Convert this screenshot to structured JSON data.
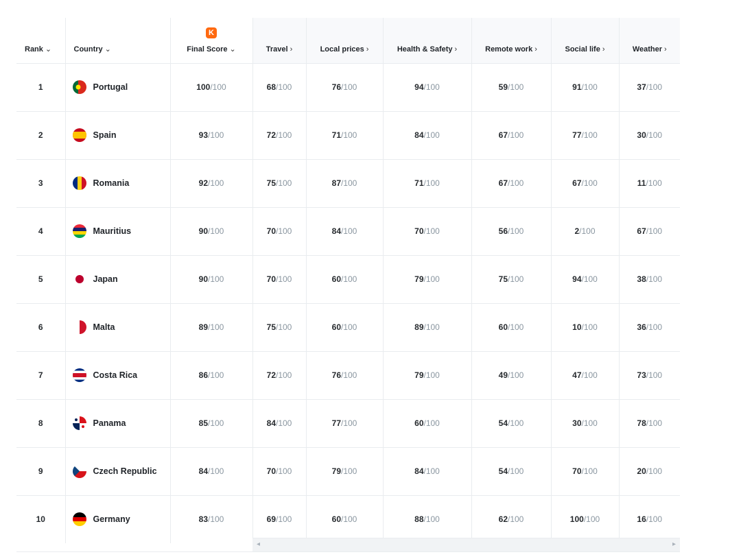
{
  "headers": {
    "rank": "Rank",
    "country": "Country",
    "final_score": "Final Score",
    "travel": "Travel",
    "local_prices": "Local prices",
    "health_safety": "Health & Safety",
    "remote_work": "Remote work",
    "social_life": "Social life",
    "weather": "Weather",
    "sort_caret": "⌄",
    "more_caret": "›",
    "logo_letter": "K"
  },
  "denominator": "/100",
  "scrollbar": {
    "left_arrow": "◂",
    "right_arrow": "▸"
  },
  "rows": [
    {
      "rank": "1",
      "country": "Portugal",
      "flag": "portugal-flag-icon",
      "scores": [
        "100",
        "68",
        "76",
        "94",
        "59",
        "91",
        "37"
      ]
    },
    {
      "rank": "2",
      "country": "Spain",
      "flag": "spain-flag-icon",
      "scores": [
        "93",
        "72",
        "71",
        "84",
        "67",
        "77",
        "30"
      ]
    },
    {
      "rank": "3",
      "country": "Romania",
      "flag": "romania-flag-icon",
      "scores": [
        "92",
        "75",
        "87",
        "71",
        "67",
        "67",
        "11"
      ]
    },
    {
      "rank": "4",
      "country": "Mauritius",
      "flag": "mauritius-flag-icon",
      "scores": [
        "90",
        "70",
        "84",
        "70",
        "56",
        "2",
        "67"
      ]
    },
    {
      "rank": "5",
      "country": "Japan",
      "flag": "japan-flag-icon",
      "scores": [
        "90",
        "70",
        "60",
        "79",
        "75",
        "94",
        "38"
      ]
    },
    {
      "rank": "6",
      "country": "Malta",
      "flag": "malta-flag-icon",
      "scores": [
        "89",
        "75",
        "60",
        "89",
        "60",
        "10",
        "36"
      ]
    },
    {
      "rank": "7",
      "country": "Costa Rica",
      "flag": "costa-rica-flag-icon",
      "scores": [
        "86",
        "72",
        "76",
        "79",
        "49",
        "47",
        "73"
      ]
    },
    {
      "rank": "8",
      "country": "Panama",
      "flag": "panama-flag-icon",
      "scores": [
        "85",
        "84",
        "77",
        "60",
        "54",
        "30",
        "78"
      ]
    },
    {
      "rank": "9",
      "country": "Czech Republic",
      "flag": "czech-republic-flag-icon",
      "scores": [
        "84",
        "70",
        "79",
        "84",
        "54",
        "70",
        "20"
      ]
    },
    {
      "rank": "10",
      "country": "Germany",
      "flag": "germany-flag-icon",
      "scores": [
        "83",
        "69",
        "60",
        "88",
        "62",
        "100",
        "16"
      ]
    }
  ],
  "colors": {
    "accent": "#ff690f",
    "denominator": "#8a96a0",
    "border": "#e9ecef"
  }
}
